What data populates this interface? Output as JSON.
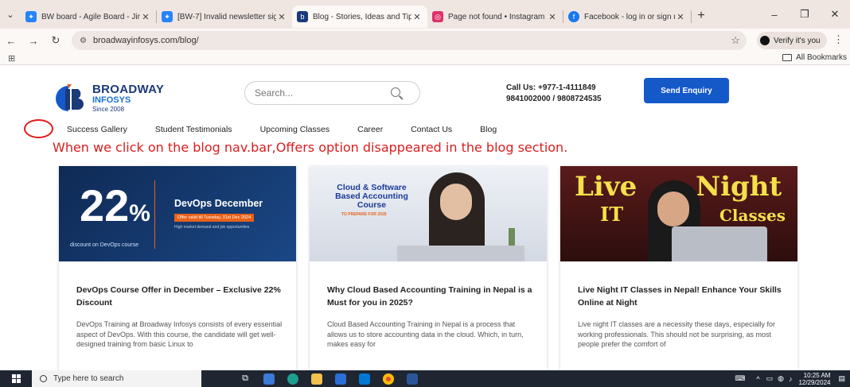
{
  "browser": {
    "tabs": [
      {
        "title": "BW board - Agile Board - Jir",
        "favicon_color": "#2684ff"
      },
      {
        "title": "[BW-7] Invalid newsletter sig",
        "favicon_color": "#2684ff"
      },
      {
        "title": "Blog - Stories, Ideas and Tip",
        "favicon_color": "#1b3a7a",
        "active": true
      },
      {
        "title": "Page not found • Instagram",
        "favicon_color": "#e1306c"
      },
      {
        "title": "Facebook - log in or sign up",
        "favicon_color": "#1877f2"
      }
    ],
    "url": "broadwayinfosys.com/blog/",
    "verify_label": "Verify it's you",
    "all_bookmarks": "All Bookmarks"
  },
  "site": {
    "logo_name": "BROADWAY",
    "logo_sub": "INFOSYS",
    "logo_since": "Since 2008",
    "search_placeholder": "Search...",
    "call_line1": "Call Us: +977-1-4111849",
    "call_line2": "9841002000 / 9808724535",
    "enquiry_label": "Send Enquiry",
    "nav": [
      "Success Gallery",
      "Student Testimonials",
      "Upcoming Classes",
      "Career",
      "Contact Us",
      "Blog"
    ]
  },
  "annotation": "When we click on the blog nav.bar,Offers option disappeared in the blog section.",
  "posts": [
    {
      "img_big": "22",
      "img_pct": "%",
      "img_small": "discount on DevOps course",
      "img_title": "DevOps December",
      "img_tag": "Offer valid till Tuesday, 31st Dec 2024",
      "img_tag2": "High market demand and job opportunities",
      "title": "DevOps Course Offer in December – Exclusive 22% Discount",
      "excerpt": "DevOps Training at Broadway Infosys consists of every essential aspect of DevOps. With this course, the candidate will get well-designed training from basic Linux to"
    },
    {
      "img_title": "Cloud & Software Based Accounting Course",
      "img_tag": "TO PREPARE FOR 2025",
      "title": "Why Cloud Based Accounting Training in Nepal is a Must for you in 2025?",
      "excerpt": "Cloud Based Accounting Training in Nepal is a process that allows us to store accounting data in the cloud. Which, in turn, makes easy for"
    },
    {
      "img_line1a": "Live",
      "img_line1b": "Night",
      "img_line2a": "IT",
      "img_line2b": "Classes",
      "title": "Live Night IT Classes in Nepal! Enhance Your Skills Online at Night",
      "excerpt": "Live night IT classes are a necessity these days, especially for working professionals. This should not be surprising, as most people prefer the comfort of"
    }
  ],
  "taskbar": {
    "search_placeholder": "Type here to search",
    "time": "10:25 AM",
    "date": "12/29/2024"
  }
}
